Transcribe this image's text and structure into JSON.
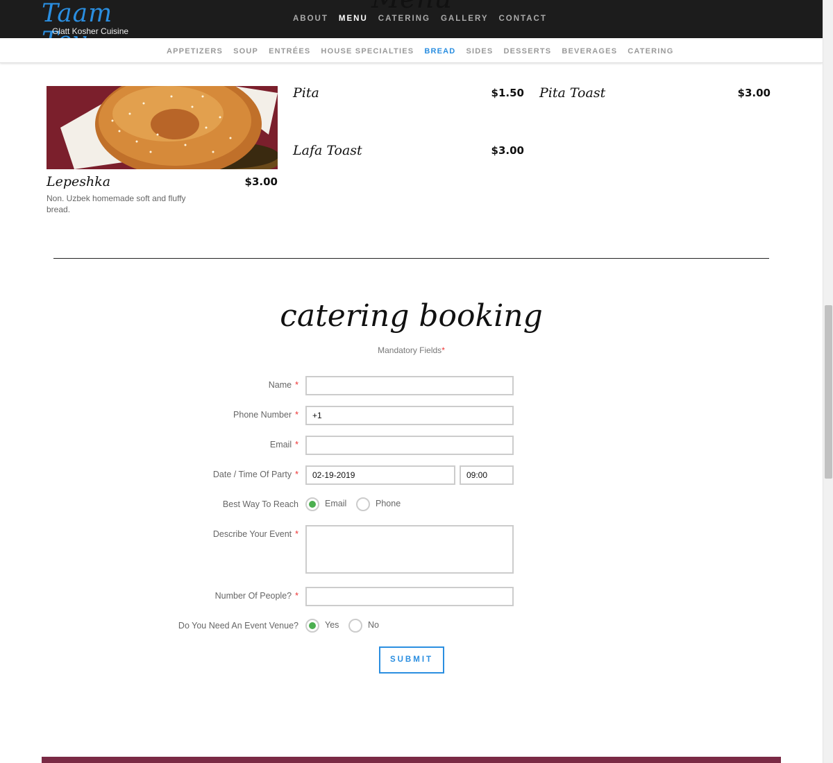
{
  "header": {
    "logo_title": "Taam Tov",
    "logo_subtitle": "Glatt Kosher Cuisine",
    "ghost_heading": "Menu",
    "nav": [
      "ABOUT",
      "MENU",
      "CATERING",
      "GALLERY",
      "CONTACT"
    ],
    "nav_active": "MENU"
  },
  "subnav": {
    "items": [
      "APPETIZERS",
      "SOUP",
      "ENTRÉES",
      "HOUSE SPECIALTIES",
      "BREAD",
      "SIDES",
      "DESSERTS",
      "BEVERAGES",
      "CATERING"
    ],
    "active": "BREAD"
  },
  "menu_items": [
    {
      "name": "Lepeshka",
      "price": "$3.00",
      "description": "Non. Uzbek homemade soft and fluffy bread."
    },
    {
      "name": "Pita",
      "price": "$1.50"
    },
    {
      "name": "Pita Toast",
      "price": "$3.00"
    },
    {
      "name": "Lafa Toast",
      "price": "$3.00"
    }
  ],
  "booking": {
    "title": "catering booking",
    "mandatory_note": "Mandatory Fields",
    "required_mark": "*",
    "fields": {
      "name": {
        "label": "Name",
        "value": ""
      },
      "phone": {
        "label": "Phone Number",
        "value": "+1"
      },
      "email": {
        "label": "Email",
        "value": ""
      },
      "date_time": {
        "label": "Date / Time Of Party",
        "date": "02-19-2019",
        "time": "09:00"
      },
      "reach": {
        "label": "Best Way To Reach",
        "options": [
          "Email",
          "Phone"
        ],
        "selected": "Email"
      },
      "event": {
        "label": "Describe Your Event",
        "value": ""
      },
      "people": {
        "label": "Number Of People?",
        "value": ""
      },
      "venue": {
        "label": "Do You Need An Event Venue?",
        "options": [
          "Yes",
          "No"
        ],
        "selected": "Yes"
      }
    },
    "submit_label": "SUBMIT"
  },
  "colors": {
    "accent": "#2a8ee0",
    "radio_checked": "#4caf50",
    "required": "#e33333",
    "header_bg": "#1c1c1c"
  }
}
